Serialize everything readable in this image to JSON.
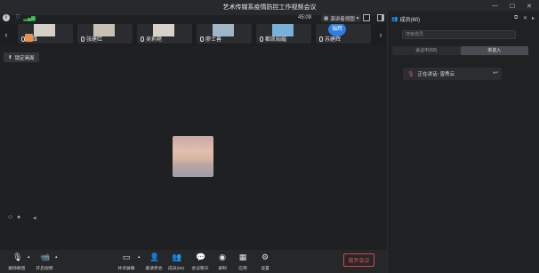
{
  "window": {
    "title": "艺术传媒系疫情防控工作视频会议"
  },
  "topbar": {
    "clock": "45:09",
    "view_mode": "演讲者视图"
  },
  "participants_strip": [
    {
      "name": "陈雄",
      "avatar_color": "#d5cfc8"
    },
    {
      "name": "张建红",
      "avatar_color": "#c8c0b2"
    },
    {
      "name": "吴莉艳",
      "avatar_color": "#d8d2c8"
    },
    {
      "name": "廖士善",
      "avatar_color": "#9fb6c8"
    },
    {
      "name": "都凯娟媚",
      "avatar_color": "#77b0d8"
    },
    {
      "name": "苏建辉",
      "avatar_color": "#2f7ee6",
      "avatar_text": "瑞辉"
    }
  ],
  "lock_button": {
    "label": "锁定画面"
  },
  "bottom_toolbar": {
    "items": [
      {
        "id": "unmute",
        "label": "解除静音",
        "icon": "mic-off-icon"
      },
      {
        "id": "start-video",
        "label": "开启视频",
        "icon": "camera-off-icon"
      },
      {
        "id": "share",
        "label": "共享屏幕",
        "icon": "share-screen-icon"
      },
      {
        "id": "invite",
        "label": "邀请参会",
        "icon": "add-user-icon"
      },
      {
        "id": "members",
        "label": "成员(60)",
        "icon": "members-icon"
      },
      {
        "id": "chat",
        "label": "会议聊天",
        "icon": "chat-icon"
      },
      {
        "id": "record",
        "label": "录制",
        "icon": "record-icon"
      },
      {
        "id": "apps",
        "label": "应用",
        "icon": "apps-icon"
      },
      {
        "id": "settings",
        "label": "设置",
        "icon": "gear-icon"
      }
    ],
    "leave_label": "离开会议",
    "leave_color": "#e84f58"
  },
  "members_panel": {
    "title": "成员(60)",
    "search_placeholder": "搜索成员",
    "tabs": [
      {
        "label": "会议中(60)",
        "active": false
      },
      {
        "label": "未进入",
        "active": true
      }
    ],
    "speaking_text": "正在讲话: 曾秀云"
  }
}
